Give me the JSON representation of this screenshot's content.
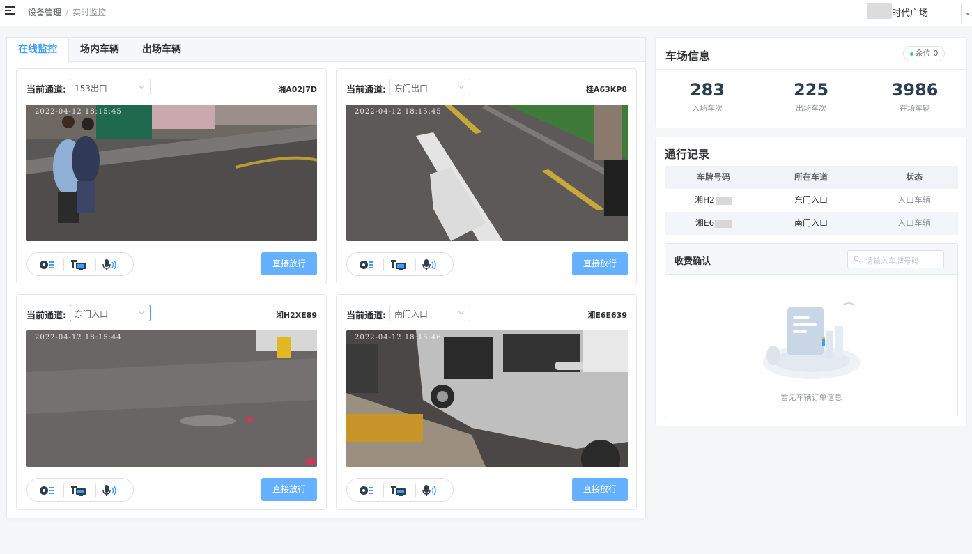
{
  "header": {
    "breadcrumb": [
      "设备管理",
      "实时监控"
    ],
    "breadcrumb_sep": "/",
    "user_name": "时代广场"
  },
  "tabs": [
    {
      "label": "在线监控",
      "active": true
    },
    {
      "label": "场内车辆",
      "active": false
    },
    {
      "label": "出场车辆",
      "active": false
    }
  ],
  "cameras": [
    {
      "channel_label": "当前通道:",
      "channel": "153出口",
      "plate": "湘A02J7D",
      "timestamp": "2022-04-12 18:15:45",
      "release_label": "直接放行"
    },
    {
      "channel_label": "当前通道:",
      "channel": "东门出口",
      "plate": "桂A63KP8",
      "timestamp": "2022-04-12 18:15:45",
      "release_label": "直接放行"
    },
    {
      "channel_label": "当前通道:",
      "channel": "东门入口",
      "plate": "湘H2XE89",
      "timestamp": "2022-04-12 18:15:44",
      "release_label": "直接放行"
    },
    {
      "channel_label": "当前通道:",
      "channel": "南门入口",
      "plate": "湘E6E639",
      "timestamp": "2022-04-12 18:15:46",
      "release_label": "直接放行"
    }
  ],
  "lot_info": {
    "title": "车场信息",
    "badge": "余位:0",
    "stats": [
      {
        "value": "283",
        "label": "入场车次"
      },
      {
        "value": "225",
        "label": "出场车次"
      },
      {
        "value": "3986",
        "label": "在场车辆"
      }
    ]
  },
  "records": {
    "title": "通行记录",
    "columns": [
      "车牌号码",
      "所在车道",
      "状态"
    ],
    "rows": [
      {
        "plate": "湘H2",
        "lane": "东门入口",
        "status": "入口车辆"
      },
      {
        "plate": "湘E6",
        "lane": "南门入口",
        "status": "入口车辆"
      }
    ]
  },
  "fee": {
    "title": "收费确认",
    "search_placeholder": "请输入车牌号码",
    "empty_text": "暂无车辆订单信息"
  },
  "colors": {
    "accent": "#409eff",
    "button": "#66b1ff",
    "badge_dot": "#3ccc9a"
  }
}
